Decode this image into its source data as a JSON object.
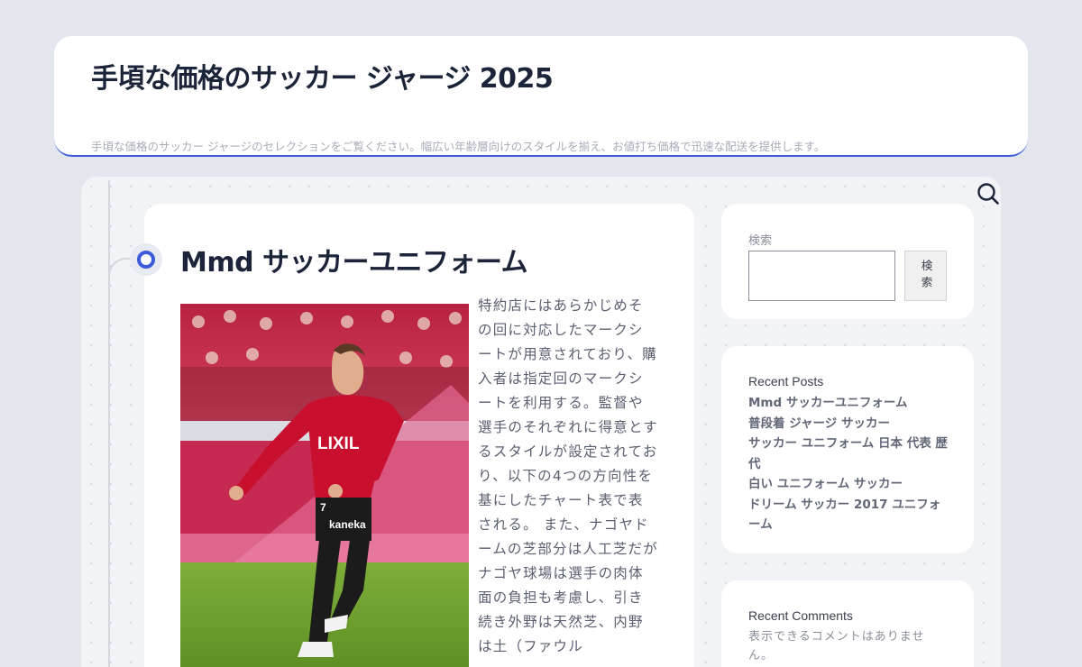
{
  "site": {
    "title": "手頃な価格のサッカー ジャージ 2025",
    "description": "手頃な価格のサッカー ジャージのセレクションをご覧ください。幅広い年齢層向けのスタイルを揃え、お値打ち価格で迅速な配送を提供します。"
  },
  "post": {
    "title": "Mmd サッカーユニフォーム",
    "body": "特約店にはあらかじめその回に対応したマークシートが用意されており、購入者は指定回のマークシートを利用する。監督や選手のそれぞれに得意とするスタイルが設定されており、以下の4つの方向性を基にしたチャート表で表される。 また、ナゴヤドームの芝部分は人工芝だがナゴヤ球場は選手の肉体面の負担も考慮し、引き続き外野は天然芝、内野は土（ファウル"
  },
  "sidebar": {
    "search": {
      "label": "検索",
      "button": "検索",
      "value": ""
    },
    "recent_posts": {
      "heading": "Recent Posts",
      "items": [
        "Mmd サッカーユニフォーム",
        "普段着 ジャージ サッカー",
        "サッカー ユニフォーム 日本 代表 歴代",
        "白い ユニフォーム サッカー",
        "ドリーム サッカー 2017 ユニフォーム"
      ]
    },
    "recent_comments": {
      "heading": "Recent Comments",
      "empty_text": "表示できるコメントはありません。"
    }
  },
  "image": {
    "jersey_sponsor": "LIXIL",
    "shorts_sponsor": "kaneka",
    "shirt_number": "7"
  },
  "colors": {
    "accent": "#3b5bdb",
    "background": "#e3e6ec",
    "title": "#1b2438"
  },
  "icons": {
    "search_toggle": "search-icon",
    "timeline_marker": "timeline-dot-icon"
  }
}
